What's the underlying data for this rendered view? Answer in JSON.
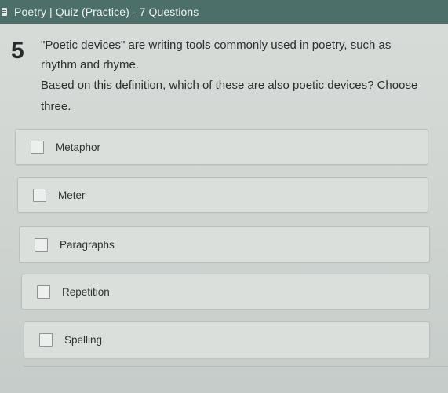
{
  "header": {
    "title": "Poetry | Quiz (Practice) - 7 Questions"
  },
  "question": {
    "number": "5",
    "text": "\"Poetic devices\" are writing tools commonly used in poetry, such as rhythm and rhyme.",
    "prompt": "Based on this definition, which of these are also poetic devices? Choose three."
  },
  "options": [
    {
      "label": "Metaphor",
      "checked": false
    },
    {
      "label": "Meter",
      "checked": false
    },
    {
      "label": "Paragraphs",
      "checked": false
    },
    {
      "label": "Repetition",
      "checked": false
    },
    {
      "label": "Spelling",
      "checked": false
    }
  ]
}
